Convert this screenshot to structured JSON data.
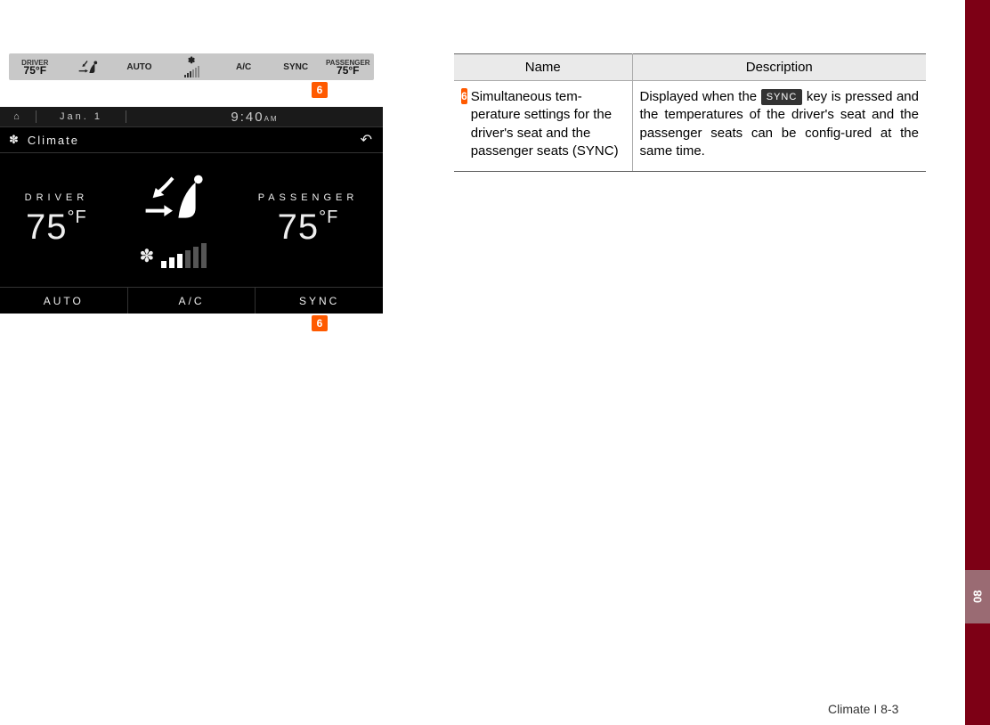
{
  "side_tab": "08",
  "footer": "Climate I 8-3",
  "compact_bar": {
    "driver_label": "DRIVER",
    "driver_temp": "75°F",
    "auto": "AUTO",
    "ac": "A/C",
    "sync": "SYNC",
    "passenger_label": "PASSENGER",
    "passenger_temp": "75°F"
  },
  "marker": "6",
  "climate": {
    "date": "Jan. 1",
    "time": "9:40",
    "ampm": "AM",
    "title": "Climate",
    "driver_label": "DRIVER",
    "driver_temp": "75",
    "passenger_label": "PASSENGER",
    "passenger_temp": "75",
    "deg_unit": "°F",
    "auto": "AUTO",
    "ac": "A/C",
    "sync": "SYNC"
  },
  "table": {
    "headers": {
      "name": "Name",
      "desc": "Description"
    },
    "rows": [
      {
        "marker": "6",
        "name": "Simultaneous tem-perature settings for the driver's seat and the passenger seats (SYNC)",
        "desc_pre": "Displayed when the ",
        "desc_key": "SYNC",
        "desc_post": " key is pressed and the temperatures of the driver's seat and the passenger seats can be config-ured at the same time."
      }
    ]
  }
}
